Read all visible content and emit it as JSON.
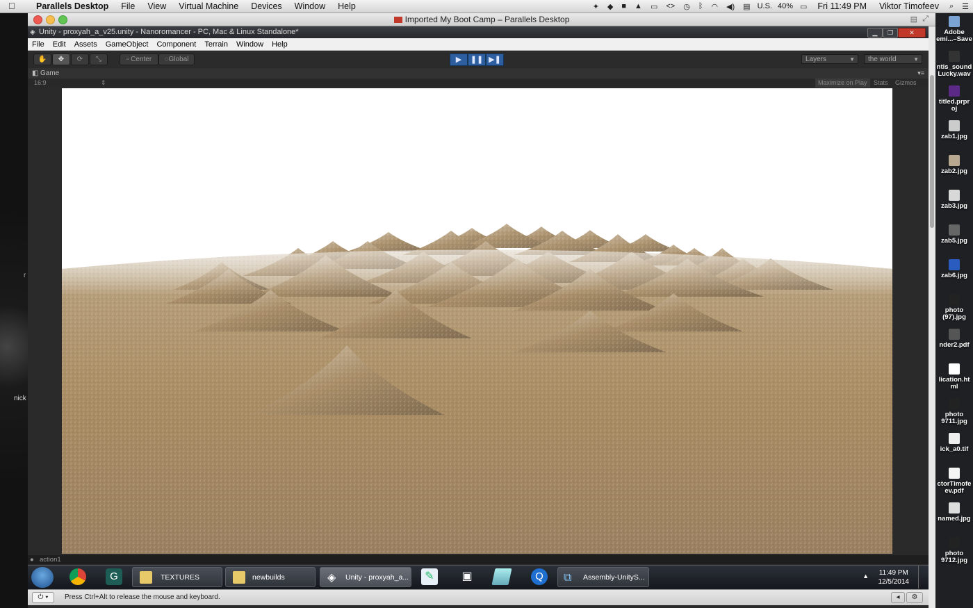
{
  "mac_menubar": {
    "app": "Parallels Desktop",
    "menus": [
      "File",
      "View",
      "Virtual Machine",
      "Devices",
      "Window",
      "Help"
    ],
    "input_source": "U.S.",
    "battery": "40%",
    "clock": "Fri 11:49 PM",
    "user": "Viktor Timofeev"
  },
  "parallels": {
    "title": "Imported My Boot Camp – Parallels Desktop"
  },
  "unity": {
    "title": "Unity - proxyah_a_v25.unity - Nanoromancer - PC, Mac & Linux Standalone*",
    "menus": [
      "File",
      "Edit",
      "Assets",
      "GameObject",
      "Component",
      "Terrain",
      "Window",
      "Help"
    ],
    "pivot": "Center",
    "space": "Global",
    "layers": "Layers",
    "layout": "the world",
    "game_tab": "Game",
    "aspect": "16:9",
    "maximize": "Maximize on Play",
    "stats": "Stats",
    "gizmos": "Gizmos",
    "status": "action1"
  },
  "taskbar": {
    "items": [
      {
        "label": "TEXTURES"
      },
      {
        "label": "newbuilds"
      },
      {
        "label": "Unity - proxyah_a..."
      },
      {
        "label": "Assembly-UnityS..."
      }
    ],
    "time": "11:49 PM",
    "date": "12/5/2014"
  },
  "parallels_status": "Press Ctrl+Alt to release the mouse and keyboard.",
  "desktop": {
    "left_label": "nick",
    "right_items": [
      "Adobe\nemi...–Save",
      "ntis_sound\nLucky.wav",
      "titled.prpr\noj",
      "zab1.jpg",
      "zab2.jpg",
      "zab3.jpg",
      "zab5.jpg",
      "zab6.jpg",
      "photo\n(97).jpg",
      "nder2.pdf",
      "lication.ht\nml",
      "photo\n9711.jpg",
      "ick_a0.tif",
      "ctorTimofe\nev.pdf",
      "named.jpg",
      "photo\n9712.jpg"
    ]
  }
}
